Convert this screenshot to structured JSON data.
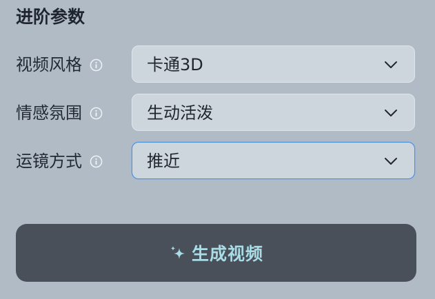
{
  "section": {
    "title": "进阶参数"
  },
  "params": [
    {
      "label": "视频风格",
      "value": "卡通3D",
      "focused": false
    },
    {
      "label": "情感氛围",
      "value": "生动活泼",
      "focused": false
    },
    {
      "label": "运镜方式",
      "value": "推近",
      "focused": true
    }
  ],
  "icons": {
    "info": "info-circle-icon",
    "dropdown": "chevron-down-icon",
    "sparkle": "sparkle-icon"
  },
  "actions": {
    "generate_label": "生成视频"
  },
  "colors": {
    "background": "#b0bbc6",
    "select_bg": "#ced6dd",
    "focus_border": "#4d8fe0",
    "button_bg": "#4a5059",
    "button_text": "#a8dce6"
  }
}
